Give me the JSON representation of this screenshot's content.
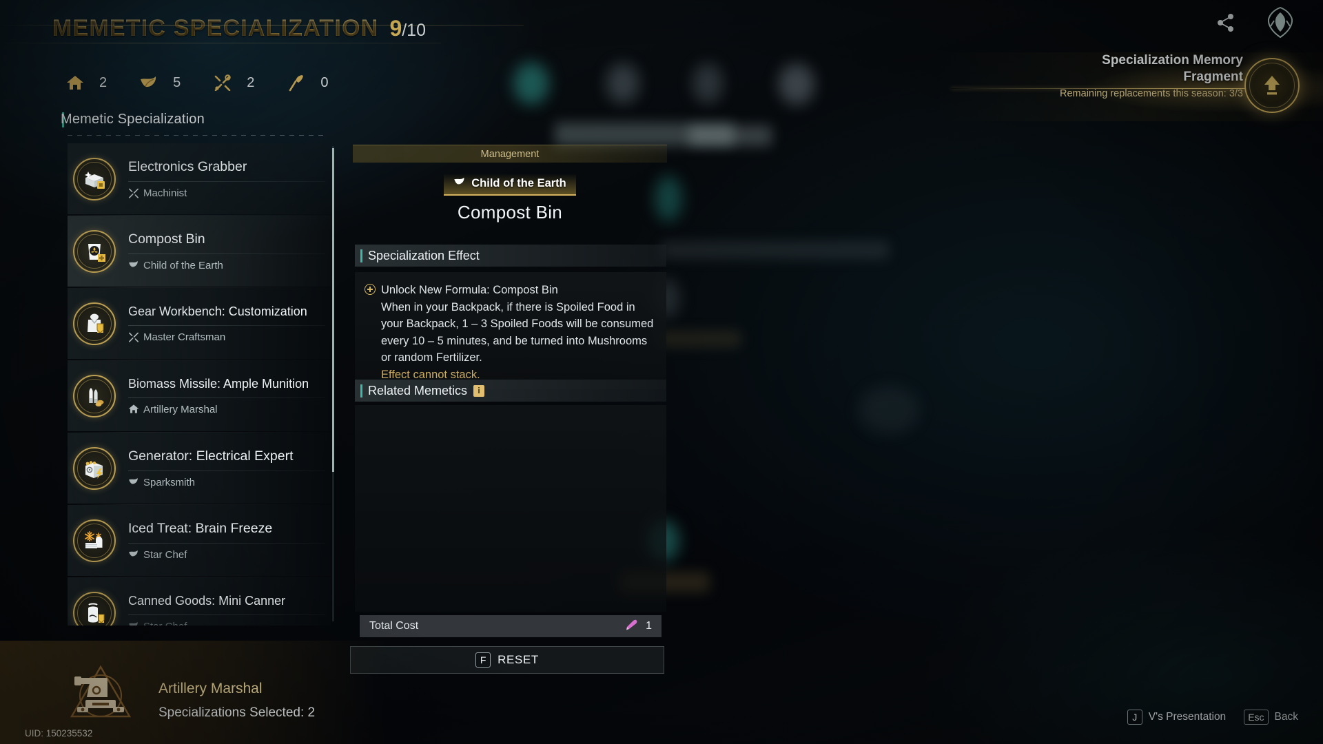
{
  "header": {
    "title": "MEMETIC SPECIALIZATION",
    "count": "9",
    "max": "/10",
    "counters": [
      {
        "icon": "home-icon",
        "value": "2"
      },
      {
        "icon": "leaf-icon",
        "value": "5"
      },
      {
        "icon": "tools-icon",
        "value": "2"
      },
      {
        "icon": "axe-icon",
        "value": "0"
      }
    ]
  },
  "top_right": {
    "share_icon": "share-icon",
    "logo_icon": "faction-helmet-logo"
  },
  "fragment": {
    "title_line1": "Specialization Memory",
    "title_line2": "Fragment",
    "subtitle": "Remaining replacements this season: 3/3",
    "orb_icon": "upgrade-arrow-icon",
    "accent": "#d8b861"
  },
  "sidebar": {
    "section_title": "Memetic Specialization",
    "accent": "#3fb8a5",
    "items": [
      {
        "name": "Electronics Grabber",
        "branch": "Machinist",
        "branch_icon": "tools-icon",
        "icon": "crate-chip-icon",
        "selected": false
      },
      {
        "name": "Compost Bin",
        "branch": "Child of the Earth",
        "branch_icon": "leaf-icon",
        "icon": "fertilizer-bag-icon",
        "selected": true
      },
      {
        "name": "Gear Workbench: Customization",
        "branch": "Master Craftsman",
        "branch_icon": "tools-icon",
        "icon": "armor-vest-icon",
        "selected": false
      },
      {
        "name": "Biomass Missile: Ample Munition",
        "branch": "Artillery Marshal",
        "branch_icon": "home-icon",
        "icon": "bullets-icon",
        "selected": false
      },
      {
        "name": "Generator: Electrical Expert",
        "branch": "Sparksmith",
        "branch_icon": "leaf-icon",
        "icon": "generator-icon",
        "selected": false
      },
      {
        "name": "Iced Treat: Brain Freeze",
        "branch": "Star Chef",
        "branch_icon": "leaf-icon",
        "icon": "snowflake-bread-icon",
        "selected": false
      },
      {
        "name": "Canned Goods: Mini Canner",
        "branch": "Star Chef",
        "branch_icon": "leaf-icon",
        "icon": "can-icon",
        "selected": false
      }
    ]
  },
  "detail": {
    "category": "Management",
    "branch": "Child of the Earth",
    "branch_icon": "leaf-icon",
    "node_title": "Compost Bin",
    "effect_header": "Specialization Effect",
    "effect_title": "Unlock New Formula: Compost Bin",
    "effect_body": "When in your Backpack, if there is Spoiled Food in your Backpack, 1 – 3 Spoiled Foods will be consumed every 10 – 5 minutes, and be turned into Mushrooms or random Fertilizer.",
    "effect_note": "Effect cannot stack.",
    "related_header": "Related Memetics",
    "related_info_badge": "i",
    "total_cost_label": "Total Cost",
    "total_cost_value": "1",
    "cost_icon": "memetic-shard-icon",
    "cost_icon_color": "#d96fd0",
    "reset_key": "F",
    "reset_label": "RESET"
  },
  "character": {
    "class_name": "Artillery Marshal",
    "selected_text": "Specializations Selected: 2",
    "emblem_icon": "artillery-cannon-emblem",
    "uid": "UID: 150235532"
  },
  "hints": [
    {
      "key": "J",
      "label": "V's Presentation"
    },
    {
      "key": "Esc",
      "label": "Back"
    }
  ]
}
